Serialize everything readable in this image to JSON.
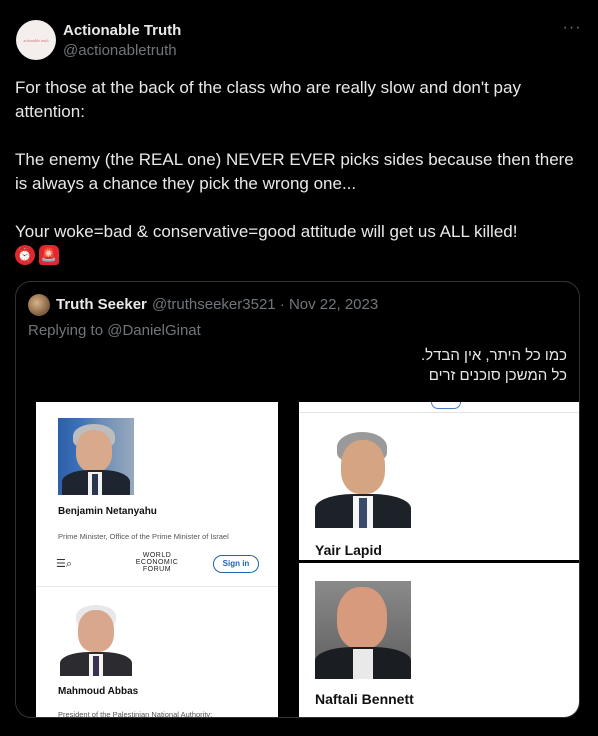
{
  "post": {
    "author_name": "Actionable Truth",
    "author_handle": "@actionabletruth",
    "avatar_text": "actionable truth",
    "more_icon": "more-icon",
    "text_line1": "For those at the back of the class who are really slow and don't pay attention:",
    "text_line2": "The enemy (the REAL one) NEVER EVER picks sides because then there is always a chance they pick the wrong one...",
    "text_line3": "Your woke=bad & conservative=good attitude will get us ALL killed!",
    "emojis": [
      "alarm-clock-emoji",
      "police-light-emoji"
    ]
  },
  "quote": {
    "author_name": "Truth Seeker",
    "author_handle_date": "@truthseeker3521 · Nov 22, 2023",
    "replying_to": "Replying to @DanielGinat",
    "hebrew_line1": "כמו כל היתר, אין הבדל.",
    "hebrew_line2": "כל המשכן סוכנים זרים",
    "image": {
      "left_panel": {
        "person1_name": "Benjamin Netanyahu",
        "person1_title": "Prime Minister, Office of the Prime Minister of Israel",
        "wef_line1": "WORLD",
        "wef_line2": "ECONOMIC",
        "wef_line3": "FORUM",
        "signin_label": "Sign in",
        "person2_name": "Mahmoud Abbas",
        "person2_title": "President of the Palestinian National Authority;"
      },
      "right_panel": {
        "person1_name": "Yair Lapid",
        "person2_name": "Naftali Bennett"
      }
    }
  },
  "colors": {
    "background": "#000000",
    "text": "#e7e9ea",
    "muted": "#71767b",
    "border": "#2f3336",
    "wef_blue": "#1a64b0"
  }
}
